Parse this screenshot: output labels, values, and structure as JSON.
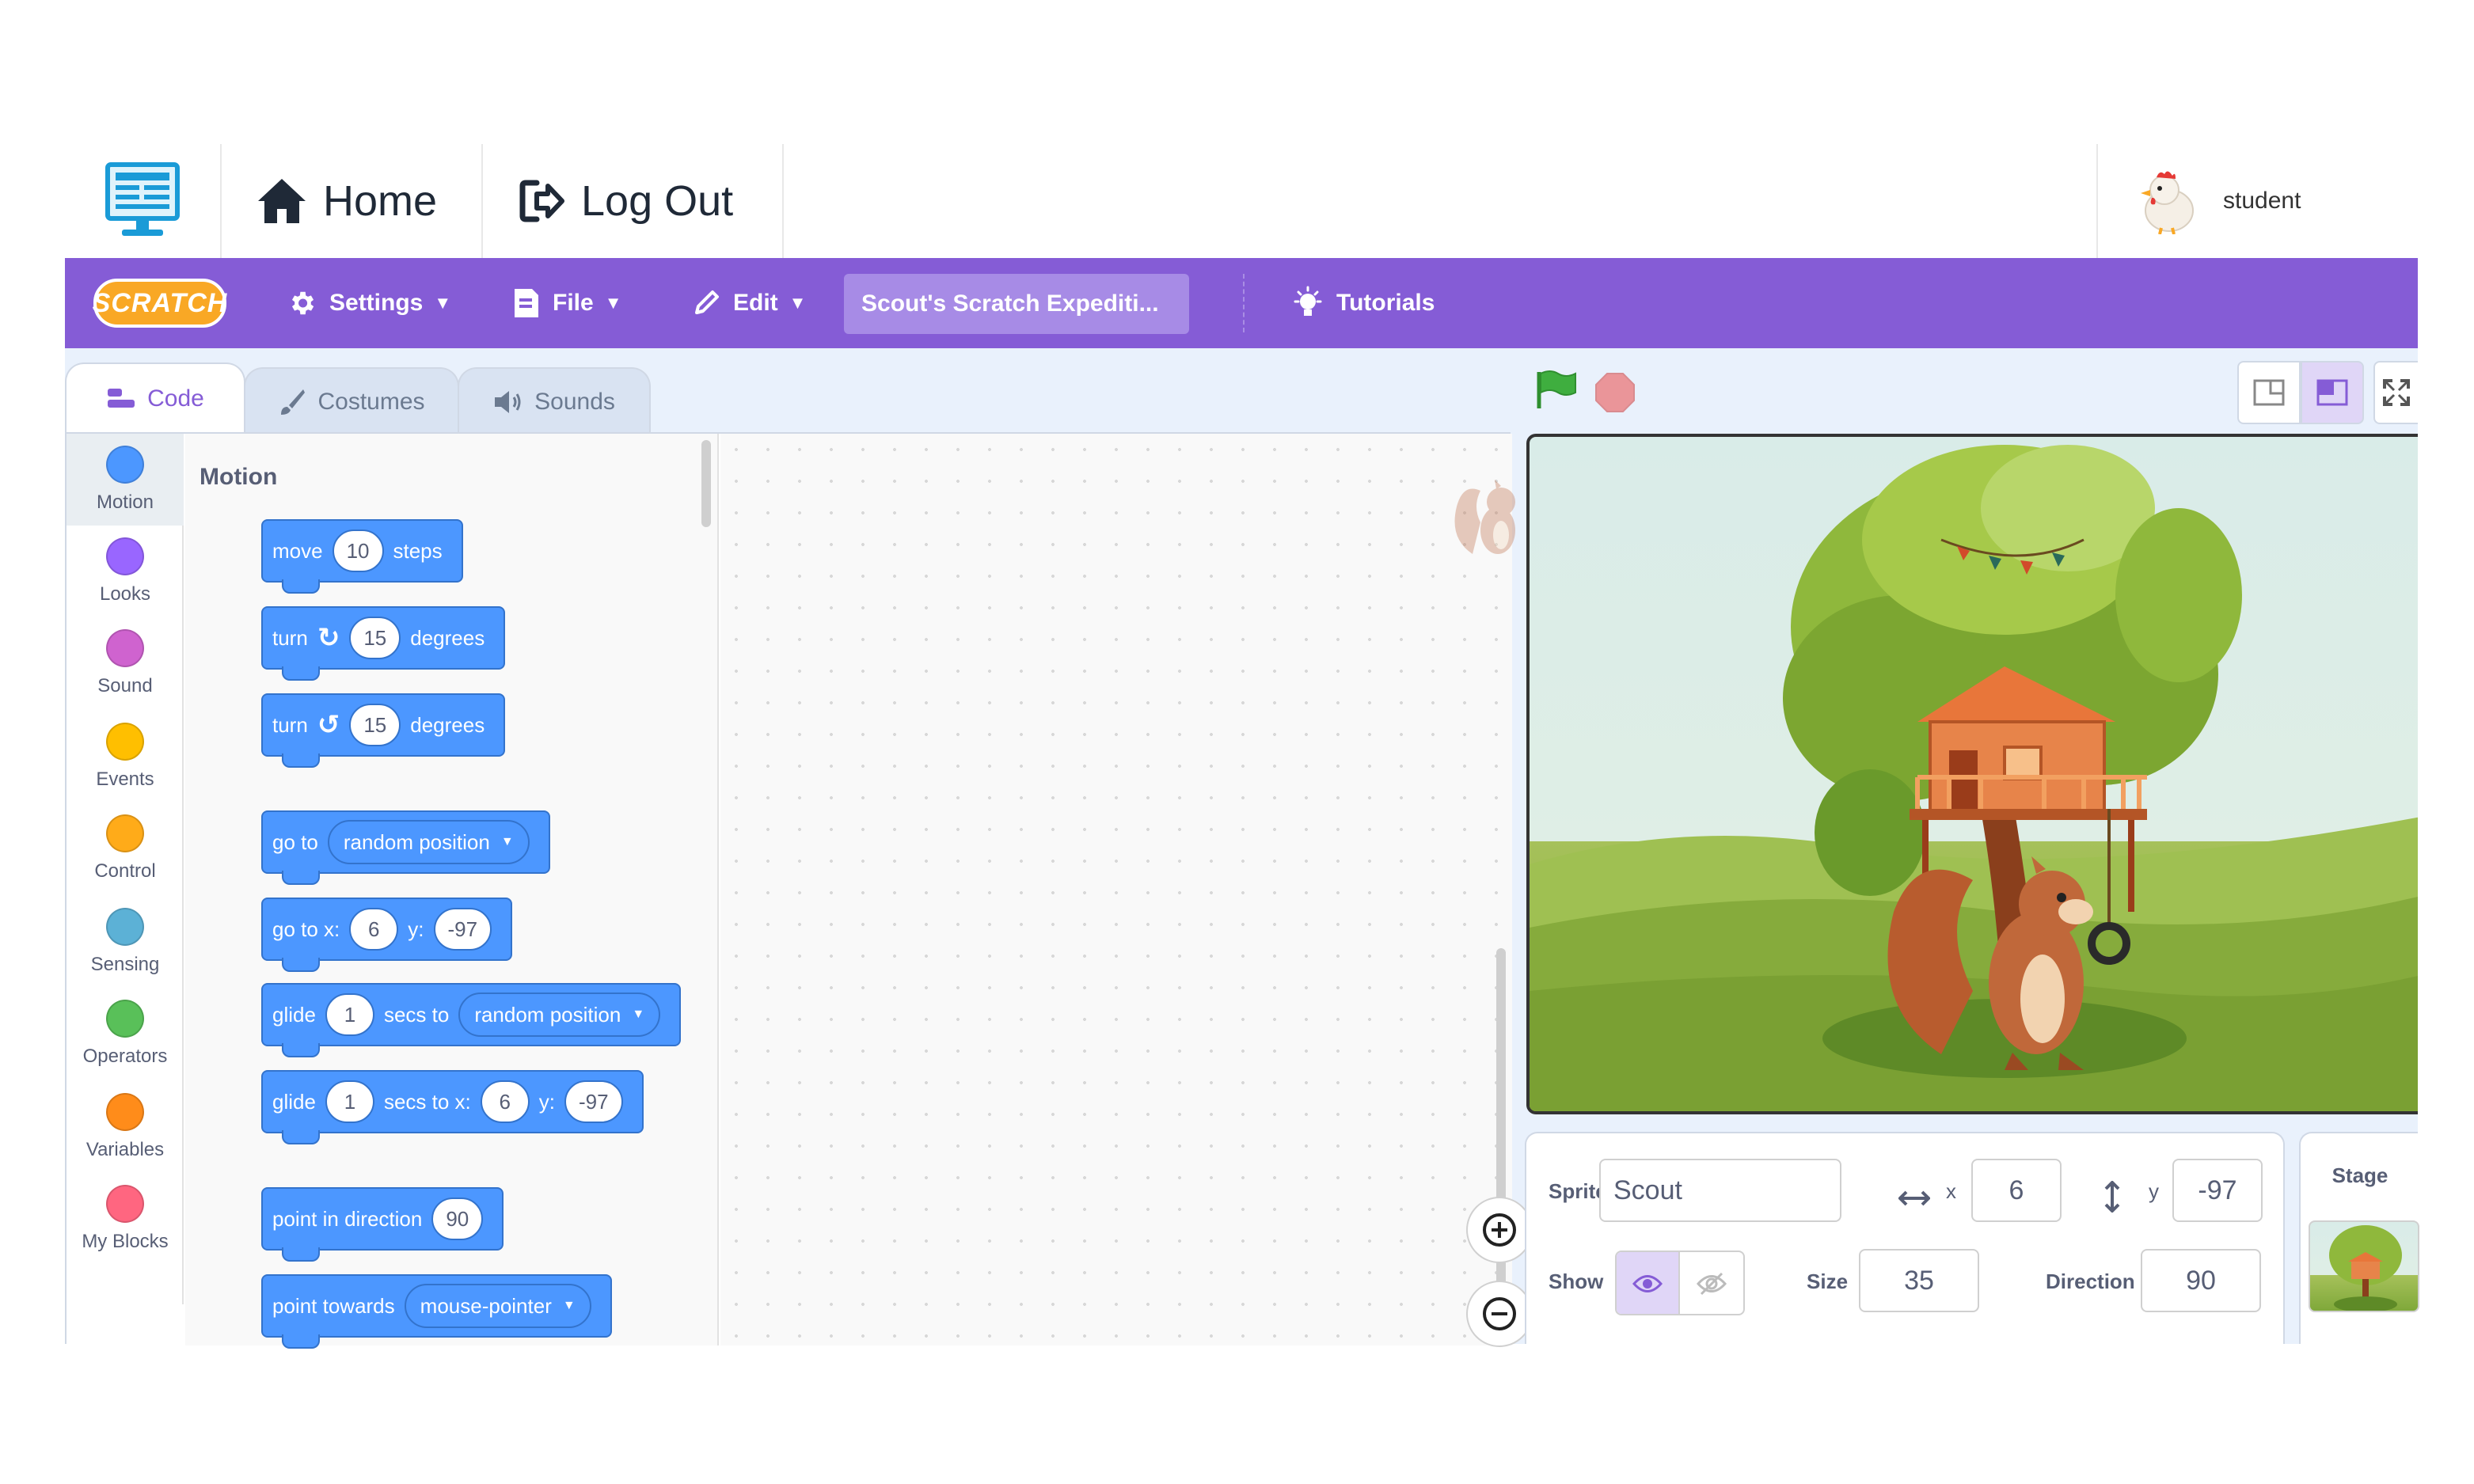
{
  "header": {
    "home_label": "Home",
    "logout_label": "Log Out",
    "user_name": "student"
  },
  "menu": {
    "logo_text": "SCRATCH",
    "settings_label": "Settings",
    "file_label": "File",
    "edit_label": "Edit",
    "project_title": "Scout's Scratch Expediti...",
    "tutorials_label": "Tutorials"
  },
  "tabs": {
    "code": "Code",
    "costumes": "Costumes",
    "sounds": "Sounds"
  },
  "categories": [
    {
      "label": "Motion",
      "color": "#4c97ff"
    },
    {
      "label": "Looks",
      "color": "#9966ff"
    },
    {
      "label": "Sound",
      "color": "#cf63cf"
    },
    {
      "label": "Events",
      "color": "#ffbf00"
    },
    {
      "label": "Control",
      "color": "#ffab19"
    },
    {
      "label": "Sensing",
      "color": "#5cb1d6"
    },
    {
      "label": "Operators",
      "color": "#59c059"
    },
    {
      "label": "Variables",
      "color": "#ff8c1a"
    },
    {
      "label": "My Blocks",
      "color": "#ff6680"
    }
  ],
  "palette": {
    "heading": "Motion",
    "blocks": {
      "move": {
        "word": "move",
        "value": "10",
        "suffix": "steps"
      },
      "turn_right": {
        "word": "turn",
        "value": "15",
        "suffix": "degrees"
      },
      "turn_left": {
        "word": "turn",
        "value": "15",
        "suffix": "degrees"
      },
      "go_to": {
        "word": "go to",
        "option": "random position"
      },
      "go_to_xy": {
        "word": "go to x:",
        "x": "6",
        "ylabel": "y:",
        "y": "-97"
      },
      "glide_to": {
        "word": "glide",
        "secs": "1",
        "mid": "secs to",
        "option": "random position"
      },
      "glide_xy": {
        "word": "glide",
        "secs": "1",
        "mid": "secs to x:",
        "x": "6",
        "ylabel": "y:",
        "y": "-97"
      },
      "point_dir": {
        "word": "point in direction",
        "value": "90"
      },
      "point_towards": {
        "word": "point towards",
        "option": "mouse-pointer"
      }
    }
  },
  "sprite_info": {
    "sprite_label": "Sprite",
    "sprite_name": "Scout",
    "x_label": "x",
    "x_value": "6",
    "y_label": "y",
    "y_value": "-97",
    "show_label": "Show",
    "size_label": "Size",
    "size_value": "35",
    "direction_label": "Direction",
    "direction_value": "90"
  },
  "stage_panel": {
    "title": "Stage"
  },
  "colors": {
    "menu_bar": "#855cd6",
    "motion_block": "#4c97ff",
    "green_flag": "#3fae3f",
    "stop": "#ec5959"
  }
}
